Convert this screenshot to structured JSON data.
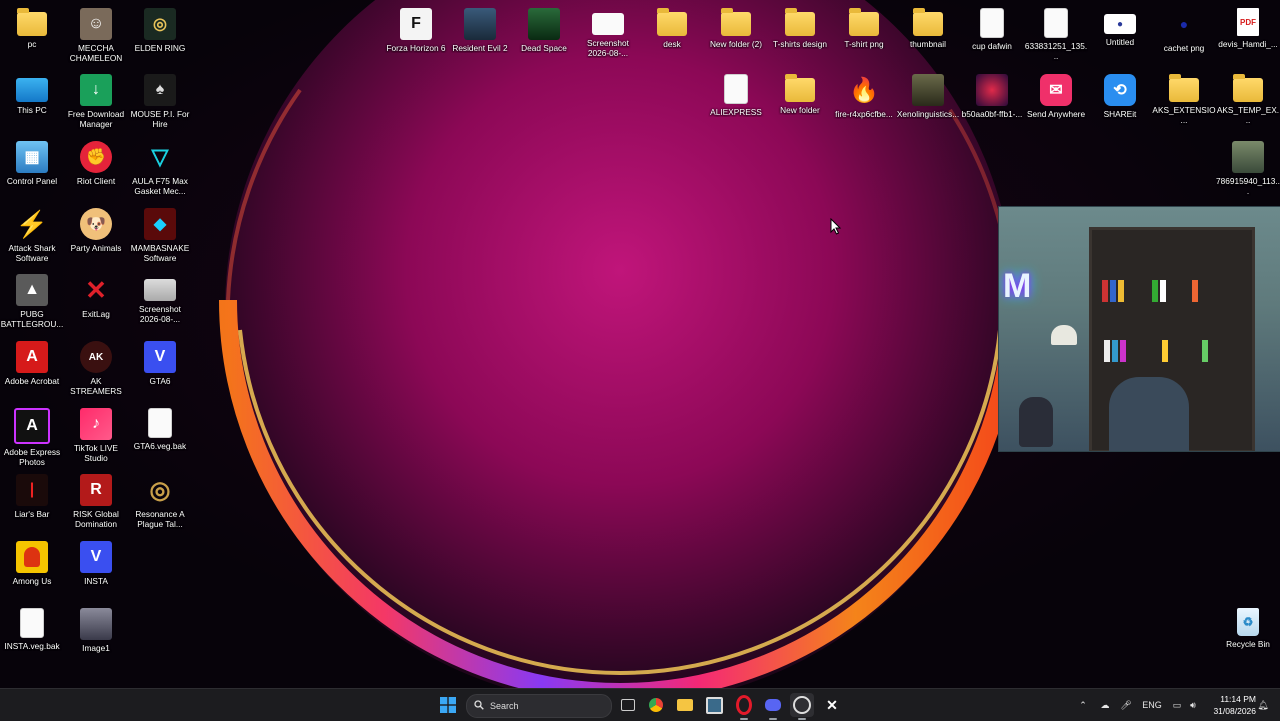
{
  "desktop": {
    "col1": [
      {
        "label": "pc",
        "icon": "folder-icon"
      },
      {
        "label": "This PC",
        "icon": "monitor-icon"
      },
      {
        "label": "Control Panel",
        "icon": "control-panel-icon"
      },
      {
        "label": "Attack Shark Software",
        "icon": "lightning-icon"
      },
      {
        "label": "PUBG BATTLEGROU...",
        "icon": "pubg-icon"
      },
      {
        "label": "Adobe Acrobat",
        "icon": "acrobat-icon"
      },
      {
        "label": "Adobe Express Photos",
        "icon": "adobe-express-icon"
      },
      {
        "label": "Liar's Bar",
        "icon": "liars-bar-icon"
      },
      {
        "label": "Among Us",
        "icon": "among-us-icon"
      },
      {
        "label": "INSTA.veg.bak",
        "icon": "file-icon"
      }
    ],
    "col2": [
      {
        "label": "MECCHA CHAMELEON",
        "icon": "game-icon"
      },
      {
        "label": "Free Download Manager",
        "icon": "download-manager-icon"
      },
      {
        "label": "Riot Client",
        "icon": "riot-fist-icon"
      },
      {
        "label": "Party Animals",
        "icon": "dog-icon"
      },
      {
        "label": "ExitLag",
        "icon": "exitlag-icon"
      },
      {
        "label": "AK STREAMERS",
        "icon": "ak-streamers-icon"
      },
      {
        "label": "TikTok LIVE Studio",
        "icon": "tiktok-icon"
      },
      {
        "label": "RISK Global Domination",
        "icon": "risk-icon"
      },
      {
        "label": "INSTA",
        "icon": "vegas-icon"
      },
      {
        "label": "Image1",
        "icon": "image-icon"
      }
    ],
    "col3": [
      {
        "label": "ELDEN RING",
        "icon": "elden-ring-icon"
      },
      {
        "label": "MOUSE P.I. For Hire",
        "icon": "mouse-pi-icon"
      },
      {
        "label": "AULA F75 Max Gasket Mec...",
        "icon": "keyboard-icon"
      },
      {
        "label": "MAMBASNAKE Software",
        "icon": "mambasnake-icon"
      },
      {
        "label": "Screenshot 2026-08-...",
        "icon": "screenshot-icon"
      },
      {
        "label": "GTA6",
        "icon": "vegas-icon"
      },
      {
        "label": "GTA6.veg.bak",
        "icon": "file-icon"
      },
      {
        "label": "Resonance A Plague Tal...",
        "icon": "resonance-icon"
      }
    ],
    "top_row": [
      {
        "label": "Forza Horizon 6",
        "icon": "forza-icon"
      },
      {
        "label": "Resident Evil 2",
        "icon": "resident-evil-icon"
      },
      {
        "label": "Dead Space",
        "icon": "dead-space-icon"
      },
      {
        "label": "Screenshot 2026-08-...",
        "icon": "screenshot-icon"
      },
      {
        "label": "desk",
        "icon": "folder-icon"
      },
      {
        "label": "New folder (2)",
        "icon": "folder-icon"
      },
      {
        "label": "T-shirts design",
        "icon": "folder-icon"
      },
      {
        "label": "T-shirt png",
        "icon": "folder-icon"
      },
      {
        "label": "thumbnail",
        "icon": "folder-icon"
      },
      {
        "label": "cup dafwin",
        "icon": "file-icon"
      },
      {
        "label": "633831251_135...",
        "icon": "image-icon"
      },
      {
        "label": "Untitled",
        "icon": "image-icon"
      },
      {
        "label": "cachet png",
        "icon": "image-icon"
      },
      {
        "label": "devis_Hamdi_...",
        "icon": "pdf-icon"
      }
    ],
    "second_row": [
      {
        "label": "ALIEXPRESS",
        "icon": "file-icon"
      },
      {
        "label": "New folder",
        "icon": "folder-icon"
      },
      {
        "label": "fire-r4xp6cfbe...",
        "icon": "fire-icon"
      },
      {
        "label": "Xenolinguistics...",
        "icon": "image-icon"
      },
      {
        "label": "b50aa0bf-ffb1-...",
        "icon": "image-icon"
      },
      {
        "label": "Send Anywhere",
        "icon": "send-anywhere-icon"
      },
      {
        "label": "SHAREit",
        "icon": "shareit-icon"
      },
      {
        "label": "AKS_EXTENSIO...",
        "icon": "folder-icon"
      },
      {
        "label": "AKS_TEMP_EX...",
        "icon": "folder-icon"
      }
    ],
    "right_col": [
      {
        "label": "786915940_113...",
        "icon": "image-icon"
      },
      {
        "label": "Recycle Bin",
        "icon": "recycle-bin-icon"
      }
    ]
  },
  "taskbar": {
    "search_label": "Search",
    "language": "ENG",
    "time": "11:14 PM",
    "date": "31/08/2026"
  }
}
